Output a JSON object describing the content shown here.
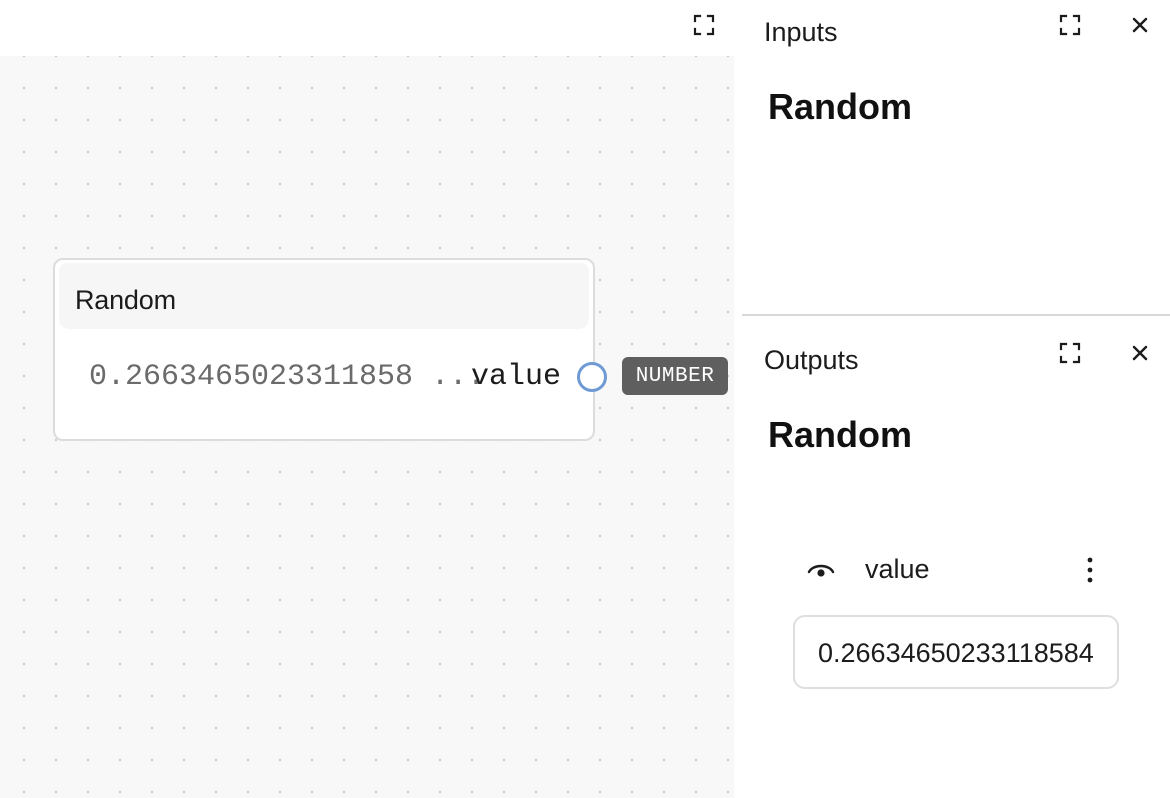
{
  "canvas": {
    "node": {
      "title": "Random",
      "value_preview": "0.2663465023311858",
      "ellipsis": "...",
      "port_label": "value",
      "port_type": "NUMBER"
    },
    "icons": {
      "fullscreen": "fullscreen-icon"
    }
  },
  "inputs_panel": {
    "title": "Inputs",
    "heading": "Random",
    "icons": {
      "fullscreen": "fullscreen-icon",
      "close": "close-icon"
    }
  },
  "outputs_panel": {
    "title": "Outputs",
    "heading": "Random",
    "output": {
      "label": "value",
      "value": "0.26634650233118584",
      "icons": {
        "visibility": "eye-icon",
        "more": "more-vertical-icon"
      }
    },
    "icons": {
      "fullscreen": "fullscreen-icon",
      "close": "close-icon"
    }
  },
  "colors": {
    "port_ring": "#6f9ad4",
    "badge_bg": "#5f5f5f",
    "canvas_bg": "#f8f8f8"
  }
}
